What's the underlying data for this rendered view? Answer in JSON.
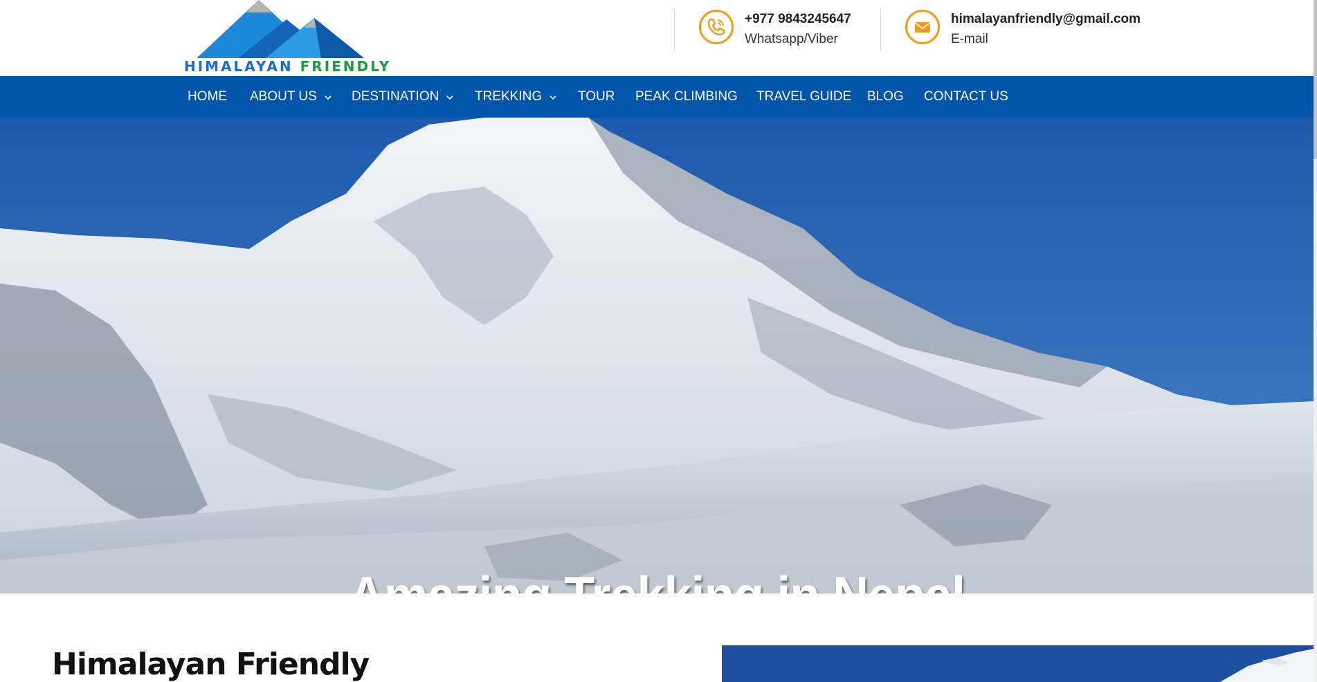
{
  "brand": {
    "logo_text_1": "HIMALAYAN",
    "logo_text_2": "FRIENDLY",
    "colors": {
      "blue": "#1c6fc4",
      "green": "#1c9a45",
      "nav": "#0055ab",
      "accent": "#f29a1a"
    }
  },
  "contacts": [
    {
      "icon": "phone-icon",
      "main": "+977 9843245647",
      "sub": "Whatsapp/Viber"
    },
    {
      "icon": "envelope-icon",
      "main": "himalayanfriendly@gmail.com",
      "sub": "E-mail"
    }
  ],
  "nav": {
    "items": [
      {
        "label": "HOME",
        "dropdown": false
      },
      {
        "label": "ABOUT US",
        "dropdown": true
      },
      {
        "label": "DESTINATION",
        "dropdown": true
      },
      {
        "label": "TREKKING",
        "dropdown": true
      },
      {
        "label": "TOUR",
        "dropdown": false
      },
      {
        "label": "PEAK CLIMBING",
        "dropdown": false
      },
      {
        "label": "TRAVEL GUIDE",
        "dropdown": false
      },
      {
        "label": "BLOG",
        "dropdown": false
      },
      {
        "label": "CONTACT US",
        "dropdown": false
      }
    ]
  },
  "hero": {
    "title": "Amazing Trekking in Nepal"
  },
  "intro": {
    "title": "Himalayan Friendly"
  }
}
